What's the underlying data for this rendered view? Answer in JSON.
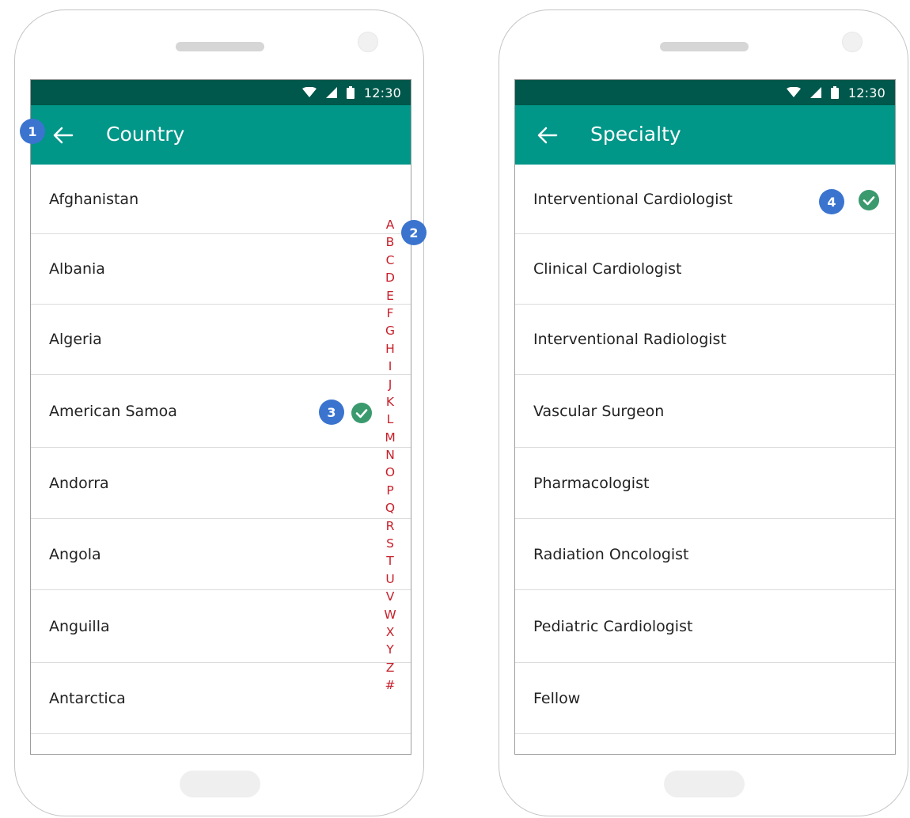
{
  "left_screen": {
    "status": {
      "time": "12:30"
    },
    "app_bar": {
      "title": "Country"
    },
    "items": [
      {
        "label": "Afghanistan"
      },
      {
        "label": "Albania"
      },
      {
        "label": "Algeria"
      },
      {
        "label": "American Samoa",
        "selected": true
      },
      {
        "label": "Andorra"
      },
      {
        "label": "Angola"
      },
      {
        "label": "Anguilla"
      },
      {
        "label": "Antarctica"
      }
    ],
    "alpha_index": [
      "A",
      "B",
      "C",
      "D",
      "E",
      "F",
      "G",
      "H",
      "I",
      "J",
      "K",
      "L",
      "M",
      "N",
      "O",
      "P",
      "Q",
      "R",
      "S",
      "T",
      "U",
      "V",
      "W",
      "X",
      "Y",
      "Z",
      "#"
    ]
  },
  "right_screen": {
    "status": {
      "time": "12:30"
    },
    "app_bar": {
      "title": "Specialty"
    },
    "items": [
      {
        "label": "Interventional Cardiologist",
        "selected": true
      },
      {
        "label": "Clinical Cardiologist"
      },
      {
        "label": "Interventional Radiologist"
      },
      {
        "label": "Vascular Surgeon"
      },
      {
        "label": "Pharmacologist"
      },
      {
        "label": "Radiation Oncologist"
      },
      {
        "label": "Pediatric Cardiologist"
      },
      {
        "label": "Fellow"
      }
    ]
  },
  "annotations": [
    "1",
    "2",
    "3",
    "4"
  ],
  "colors": {
    "status_bar": "#00574b",
    "app_bar": "#009688",
    "check": "#3a9a6e",
    "badge": "#3a74cf",
    "index_letters": "#c8202b"
  },
  "icons": {
    "back": "arrow-left-icon",
    "check": "check-circle-icon",
    "wifi": "wifi-icon",
    "signal": "signal-icon",
    "battery": "battery-icon"
  }
}
